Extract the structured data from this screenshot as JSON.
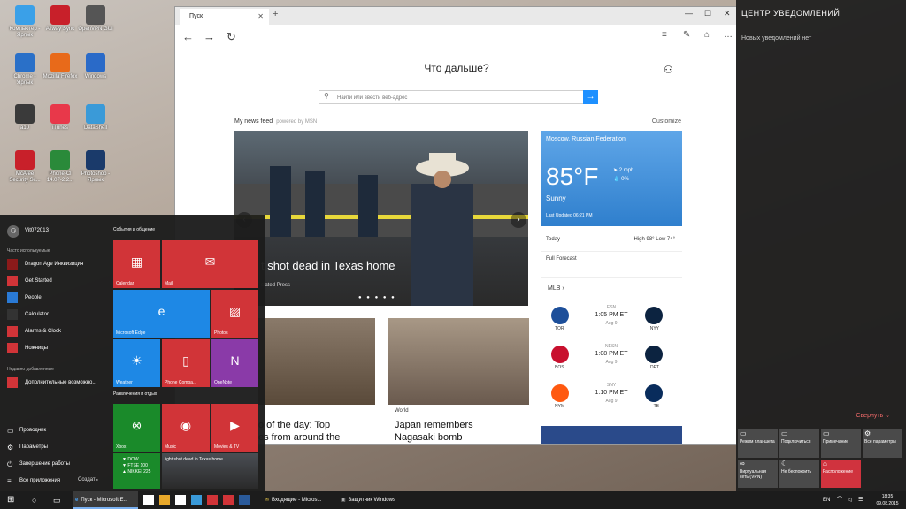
{
  "desktop": {
    "icons": [
      {
        "label": "Компьютер - Ярлык",
        "color": "#3aa0e8"
      },
      {
        "label": "Allway Sync",
        "color": "#c8202a"
      },
      {
        "label": "OpenVPN GUI",
        "color": "#555"
      },
      {
        "label": "Chrome - Ярлык",
        "color": "#2a70c8"
      },
      {
        "label": "Mozilla Firefox",
        "color": "#e86a1a"
      },
      {
        "label": "Windows",
        "color": "#2a6ac8"
      },
      {
        "label": "a10",
        "color": "#3a3a3a"
      },
      {
        "label": "iTunes",
        "color": "#e8384a"
      },
      {
        "label": "DataShell",
        "color": "#3a9ad8"
      },
      {
        "label": "McAfee Security Sc...",
        "color": "#c8202a"
      },
      {
        "label": "Phone-Cl 14.07-2.2...",
        "color": "#2a8a3a"
      },
      {
        "label": "Photoshop - Ярлык",
        "color": "#1a3a6a"
      }
    ]
  },
  "edge": {
    "tab_title": "Пуск",
    "new_tab": "+",
    "heading": "Что дальше?",
    "search_placeholder": "Найти или ввести веб-адрес",
    "news_feed": "My news feed",
    "powered": "powered by MSN",
    "customize": "Customize",
    "hero_caption": "t shot dead in Texas home",
    "hero_source": "ciated Press",
    "weather": {
      "location": "Moscow, Russian Federation",
      "temp": "85°F",
      "condition": "Sunny",
      "updated": "Last Updated 06:21 PM",
      "wind": "2 mph",
      "precip": "0%",
      "today_label": "Today",
      "today_value": "High 98° Low 74°",
      "full_forecast": "Full Forecast"
    },
    "mlb": {
      "header": "MLB",
      "games": [
        {
          "away": "TOR",
          "home": "NYY",
          "net": "ESN",
          "time": "1:05 PM ET",
          "date": "Aug 9",
          "away_color": "#1d4f9a",
          "home_color": "#0c2340"
        },
        {
          "away": "BOS",
          "home": "DET",
          "net": "NESN",
          "time": "1:08 PM ET",
          "date": "Aug 9",
          "away_color": "#c8102e",
          "home_color": "#0c2340"
        },
        {
          "away": "NYM",
          "home": "TB",
          "net": "SNY",
          "time": "1:10 PM ET",
          "date": "Aug 9",
          "away_color": "#ff5910",
          "home_color": "#092c5c"
        }
      ]
    },
    "cards": [
      {
        "category": "",
        "title": "o of the day: Top\nes from around the"
      },
      {
        "category": "World",
        "title": "Japan remembers\nNagasaki bomb"
      }
    ]
  },
  "notif": {
    "title": "ЦЕНТР УВЕДОМЛЕНИЙ",
    "subtitle": "Новых уведомлений нет",
    "collapse": "Свернуть",
    "actions": [
      {
        "label": "Режим планшета",
        "icon": "▭"
      },
      {
        "label": "Подключиться",
        "icon": "▭"
      },
      {
        "label": "Примечание",
        "icon": "▭"
      },
      {
        "label": "Все параметры",
        "icon": "⚙"
      },
      {
        "label": "Виртуальная сеть (VPN)",
        "icon": "∞"
      },
      {
        "label": "Не беспокоить",
        "icon": "☾"
      },
      {
        "label": "Расположение",
        "icon": "⌂"
      }
    ]
  },
  "start": {
    "user": "Vit072013",
    "most_used": "Часто используемые",
    "recent": "Недавно добавленные",
    "apps": [
      {
        "label": "Dragon Age Инквизиция",
        "color": "#8b1a1a"
      },
      {
        "label": "Get Started",
        "color": "#d13438"
      },
      {
        "label": "People",
        "color": "#2a7ad5"
      },
      {
        "label": "Calculator",
        "color": "#333"
      },
      {
        "label": "Alarms & Clock",
        "color": "#d13438"
      },
      {
        "label": "Ножницы",
        "color": "#d13438"
      }
    ],
    "recent_app": "Дополнительные возможно...",
    "bottom": [
      {
        "label": "Проводник",
        "icon": "▭"
      },
      {
        "label": "Параметры",
        "icon": "⚙"
      },
      {
        "label": "Завершение работы",
        "icon": "⏻"
      },
      {
        "label": "Все приложения",
        "icon": "≡"
      }
    ],
    "create": "Создать",
    "group1": "События и общение",
    "group2": "Развлечения и отдых",
    "tiles": [
      {
        "label": "Calendar",
        "icon": "▦",
        "color": "#d13438"
      },
      {
        "label": "Mail",
        "icon": "✉",
        "color": "#d13438"
      },
      {
        "label": "Microsoft Edge",
        "icon": "e",
        "color": "#1e88e5"
      },
      {
        "label": "Photos",
        "icon": "▨",
        "color": "#d13438"
      },
      {
        "label": "Weather",
        "icon": "☀",
        "color": "#1e88e5"
      },
      {
        "label": "Phone Compa...",
        "icon": "▯",
        "color": "#d13438"
      },
      {
        "label": "OneNote",
        "icon": "N",
        "color": "#8a3aa8"
      },
      {
        "label": "Xbox",
        "icon": "⊗",
        "color": "#1a8a2a"
      },
      {
        "label": "Music",
        "icon": "◉",
        "color": "#d13438"
      },
      {
        "label": "Movies & TV",
        "icon": "▶",
        "color": "#d13438"
      }
    ],
    "money": {
      "l1": "▼ DOW",
      "l2": "▼ FTSE 100",
      "l3": "▲ NIKKEI 225"
    },
    "news_tile": "ight shot dead in Texas home"
  },
  "taskbar": {
    "edge_label": "Пуск - Microsoft E...",
    "mail_label": "Входящие - Micros...",
    "defender_label": "Защитник Windows",
    "lang": "EN",
    "time": "18:35",
    "date": "09.08.2015"
  }
}
